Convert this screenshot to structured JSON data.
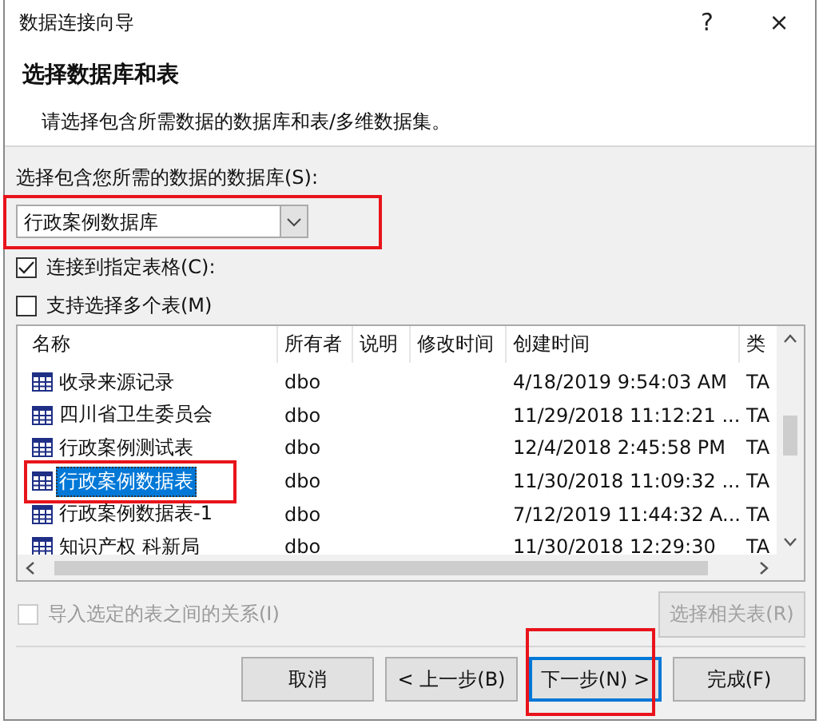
{
  "window": {
    "title": "数据连接向导",
    "help": "?",
    "close": "×"
  },
  "header": {
    "title": "选择数据库和表",
    "subtitle": "请选择包含所需数据的数据库和表/多维数据集。"
  },
  "database": {
    "label": "选择包含您所需的数据的数据库(S):",
    "value": "行政案例数据库",
    "highlighted": true
  },
  "options": [
    {
      "label": "连接到指定表格(C):",
      "checked": true,
      "disabled": false
    },
    {
      "label": "支持选择多个表(M)",
      "checked": false,
      "disabled": false
    }
  ],
  "table": {
    "columns": [
      "名称",
      "所有者",
      "说明",
      "修改时间",
      "创建时间",
      "类"
    ],
    "rows": [
      {
        "name": "收录来源记录",
        "owner": "dbo",
        "created": "4/18/2019 9:54:03 AM",
        "type": "TA",
        "selected": false,
        "highlighted": false
      },
      {
        "name": "四川省卫生委员会",
        "owner": "dbo",
        "created": "11/29/2018 11:12:21 ...",
        "type": "TA",
        "selected": false,
        "highlighted": false
      },
      {
        "name": "行政案例测试表",
        "owner": "dbo",
        "created": "12/4/2018 2:45:58 PM",
        "type": "TA",
        "selected": false,
        "highlighted": false
      },
      {
        "name": "行政案例数据表",
        "owner": "dbo",
        "created": "11/30/2018 11:09:32 ...",
        "type": "TA",
        "selected": true,
        "highlighted": true
      },
      {
        "name": "行政案例数据表-1",
        "owner": "dbo",
        "created": "7/12/2019 11:44:32 A...",
        "type": "TA",
        "selected": false,
        "highlighted": false
      },
      {
        "name": "知识产权 科新局",
        "owner": "dbo",
        "created": "11/30/2018 12:29:30",
        "type": "TA",
        "selected": false,
        "highlighted": false
      }
    ]
  },
  "relations": {
    "checkbox": {
      "label": "导入选定的表之间的关系(I)",
      "checked": false,
      "disabled": true
    },
    "button": {
      "label": "选择相关表(R)",
      "disabled": true
    }
  },
  "buttons": [
    {
      "label": "取消",
      "default": false,
      "highlighted": false
    },
    {
      "label": "< 上一步(B)",
      "default": false,
      "highlighted": false
    },
    {
      "label": "下一步(N) >",
      "default": true,
      "highlighted": true
    },
    {
      "label": "完成(F)",
      "default": false,
      "highlighted": false
    }
  ]
}
